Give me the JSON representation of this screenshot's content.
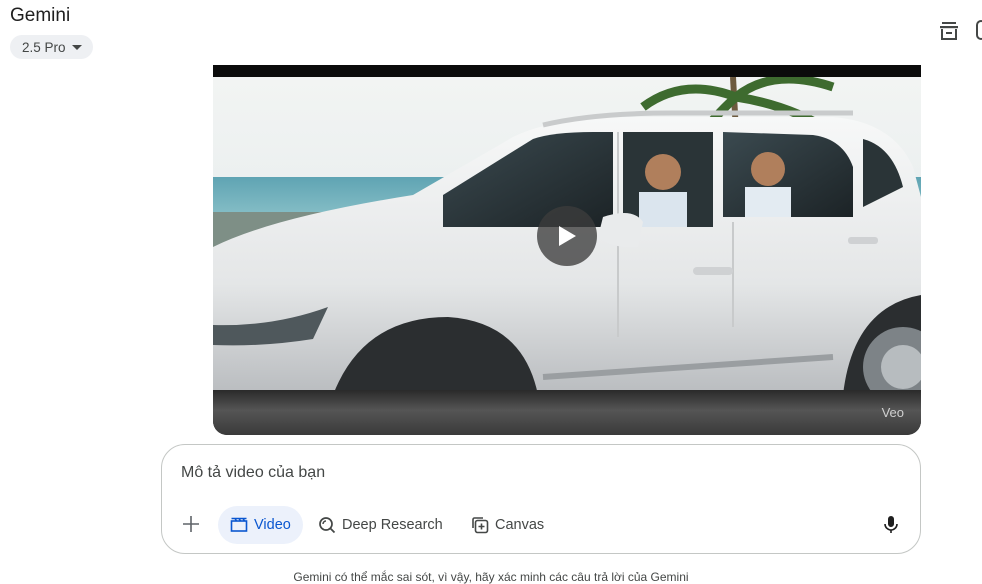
{
  "header": {
    "app_title": "Gemini",
    "model_label": "2.5 Pro",
    "model_caret_icon": "caret-down-icon",
    "archive_icon": "archive-icon"
  },
  "video": {
    "watermark": "Veo",
    "play_icon": "play-icon",
    "thumbnail": "white-suv-on-coastal-road"
  },
  "composer": {
    "placeholder": "Mô tả video của bạn",
    "value": "",
    "plus_icon": "plus-icon",
    "mic_icon": "microphone-icon",
    "tools": [
      {
        "label": "Video",
        "icon": "clapperboard-icon",
        "active": true
      },
      {
        "label": "Deep Research",
        "icon": "research-icon",
        "active": false
      },
      {
        "label": "Canvas",
        "icon": "canvas-icon",
        "active": false
      }
    ]
  },
  "footer": {
    "disclaimer": "Gemini có thể mắc sai sót, vì vậy, hãy xác minh các câu trả lời của Gemini"
  },
  "colors": {
    "accent": "#0b57d0",
    "chip_bg": "#eef0f3",
    "active_tool_bg": "#ecf1fb",
    "border": "#c4c7c5"
  }
}
